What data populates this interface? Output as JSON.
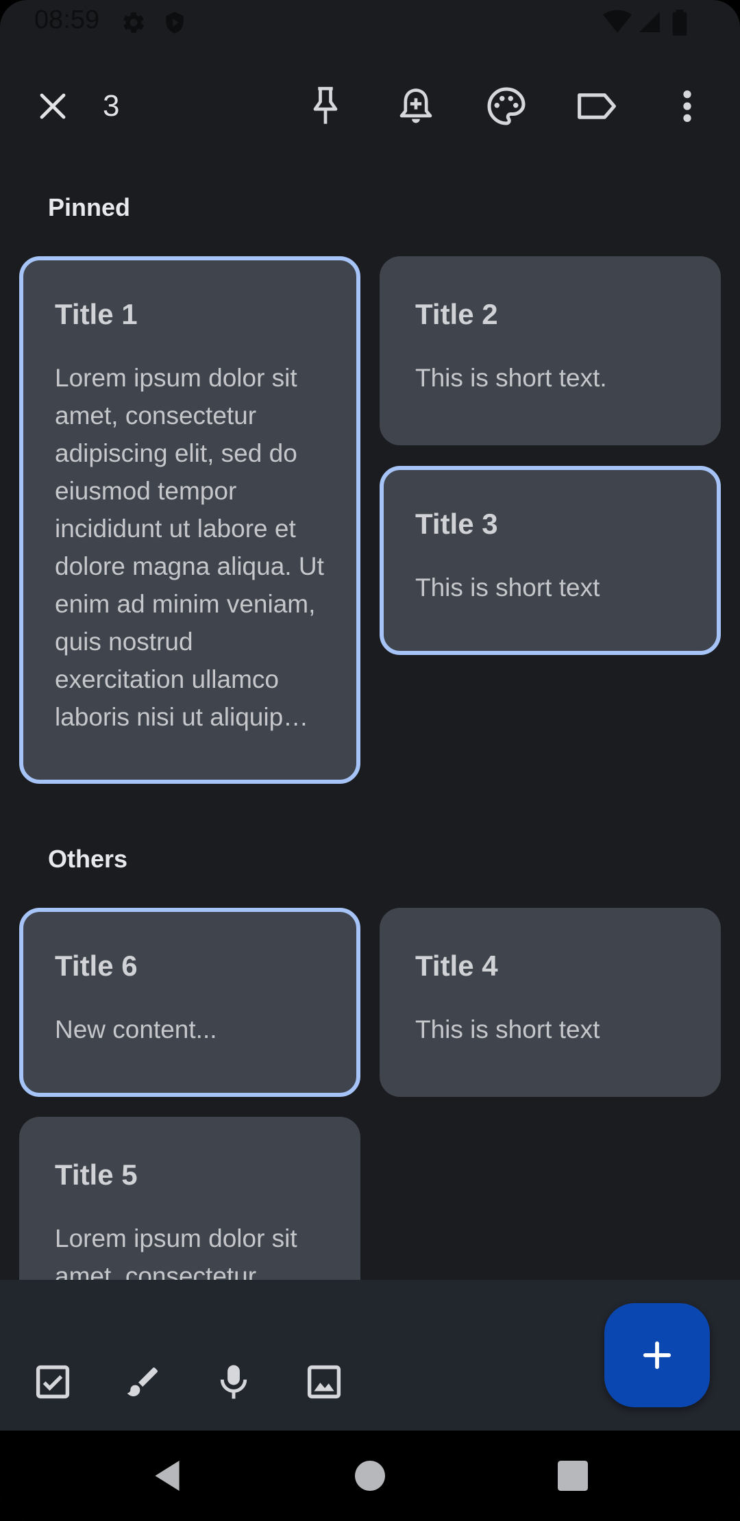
{
  "status_bar": {
    "time": "08:59"
  },
  "action_bar": {
    "selection_count": "3",
    "icons": [
      "close-icon",
      "pin-icon",
      "add-reminder-icon",
      "palette-icon",
      "label-icon",
      "more-vert-icon"
    ]
  },
  "sections": {
    "pinned_label": "Pinned",
    "others_label": "Others"
  },
  "notes": {
    "title1": {
      "title": "Title 1",
      "body": "Lorem ipsum dolor sit amet, consectetur adipiscing elit, sed do eiusmod tempor incididunt ut labore et dolore magna aliqua. Ut enim ad minim veniam, quis nostrud exercitation ullamco laboris nisi ut aliquip…",
      "selected": true
    },
    "title2": {
      "title": "Title 2",
      "body": "This is short text.",
      "selected": false
    },
    "title3": {
      "title": "Title 3",
      "body": "This is short text",
      "selected": true
    },
    "title6": {
      "title": "Title 6",
      "body": "New content...",
      "selected": true
    },
    "title4": {
      "title": "Title 4",
      "body": "This is short text",
      "selected": false
    },
    "title5": {
      "title": "Title 5",
      "body": "Lorem ipsum dolor sit amet, consectetur",
      "selected": false
    }
  },
  "bottom_bar": {
    "icons": [
      "checkbox-icon",
      "brush-icon",
      "mic-icon",
      "image-icon"
    ],
    "fab_icon": "plus-icon"
  },
  "colors": {
    "background": "#1b1c1f",
    "card": "#40454d",
    "selected_border": "#a6c4f7",
    "fab": "#0b47b0",
    "bottom_bar": "#22262d"
  }
}
